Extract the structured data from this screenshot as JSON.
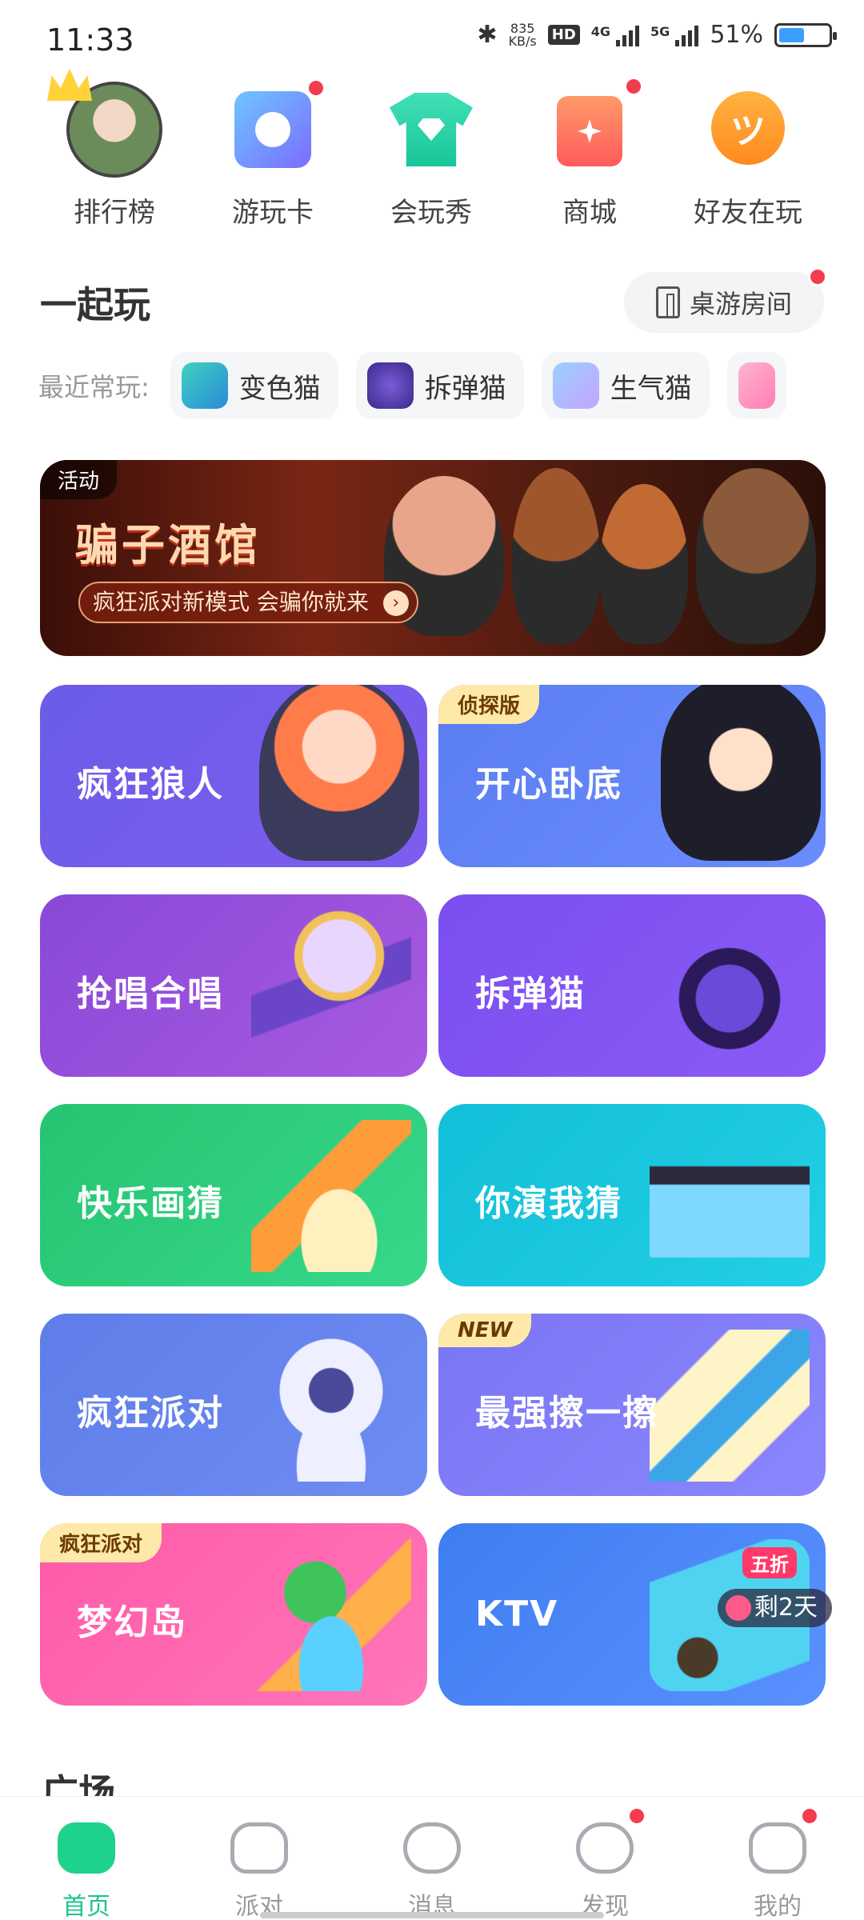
{
  "status": {
    "time": "11:33",
    "speed_value": "835",
    "speed_unit": "KB/s",
    "hd_label": "HD",
    "net1": "4G",
    "net2": "5G",
    "battery": "51%",
    "battery_level": 0.51
  },
  "top_nav": [
    {
      "label": "排行榜",
      "icon": "ranking-avatar-icon"
    },
    {
      "label": "游玩卡",
      "icon": "play-card-icon"
    },
    {
      "label": "会玩秀",
      "icon": "tshirt-gem-icon"
    },
    {
      "label": "商城",
      "icon": "shopping-bag-icon"
    },
    {
      "label": "好友在玩",
      "icon": "smile-face-icon"
    }
  ],
  "section": {
    "title": "一起玩",
    "room_button": "桌游房间"
  },
  "recent": {
    "label": "最近常玩:",
    "items": [
      "变色猫",
      "拆弹猫",
      "生气猫"
    ]
  },
  "banner": {
    "tag": "活动",
    "title": "骗子酒馆",
    "subtitle": "疯狂派对新模式 会骗你就来",
    "arrow": "›"
  },
  "cards": [
    {
      "name": "疯狂狼人",
      "badge": ""
    },
    {
      "name": "开心卧底",
      "badge": "侦探版"
    },
    {
      "name": "抢唱合唱",
      "badge": ""
    },
    {
      "name": "拆弹猫",
      "badge": ""
    },
    {
      "name": "快乐画猜",
      "badge": ""
    },
    {
      "name": "你演我猜",
      "badge": ""
    },
    {
      "name": "疯狂派对",
      "badge": ""
    },
    {
      "name": "最强擦一擦",
      "badge": "NEW"
    },
    {
      "name": "梦幻岛",
      "badge": "疯狂派对"
    },
    {
      "name": "KTV",
      "badge": ""
    }
  ],
  "ktv": {
    "sale": "五折",
    "countdown": "剩2天"
  },
  "plaza_title": "广场",
  "bottom_nav": [
    {
      "label": "首页"
    },
    {
      "label": "派对"
    },
    {
      "label": "消息"
    },
    {
      "label": "发现"
    },
    {
      "label": "我的"
    }
  ],
  "colors": {
    "accent": "#1fd28c",
    "badge_red": "#f33c4e"
  }
}
